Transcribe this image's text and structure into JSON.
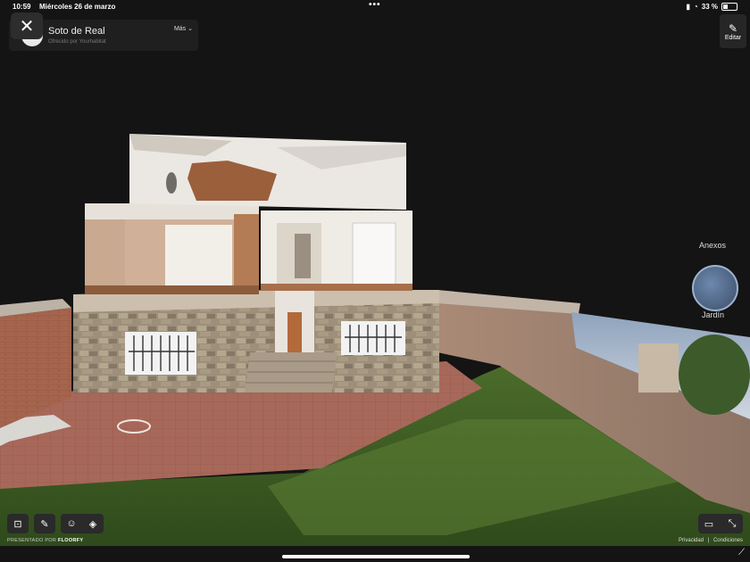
{
  "status_bar": {
    "time": "10:59",
    "date": "Miércoles 26 de marzo",
    "battery": "33 %",
    "battery_level": 0.33
  },
  "header": {
    "title": "Soto de Real",
    "subtitle": "Ofrecido por Yourhabitat",
    "language": "Más"
  },
  "edit": {
    "label": "Editar"
  },
  "annexes": {
    "title": "Anexos",
    "items": [
      {
        "label": "Jardín"
      }
    ]
  },
  "footer": {
    "powered_prefix": "PRESENTADO POR",
    "powered_brand": "FLOORFY",
    "privacy": "Privacidad",
    "separator": "|",
    "conditions": "Condiciones"
  },
  "icons": {
    "close": "close-icon",
    "back": "chevron-left-icon",
    "language": "chevron-down-icon",
    "edit": "pencil-icon",
    "floorplan": "floorplan-icon",
    "measure": "ruler-icon",
    "walk": "person-icon",
    "layers": "layers-icon",
    "vr": "vr-headset-icon",
    "fullscreen": "fullscreen-exit-icon"
  },
  "colors": {
    "background": "#141414",
    "panel": "#1f1f1f",
    "logo_accent": "#c0302c"
  }
}
